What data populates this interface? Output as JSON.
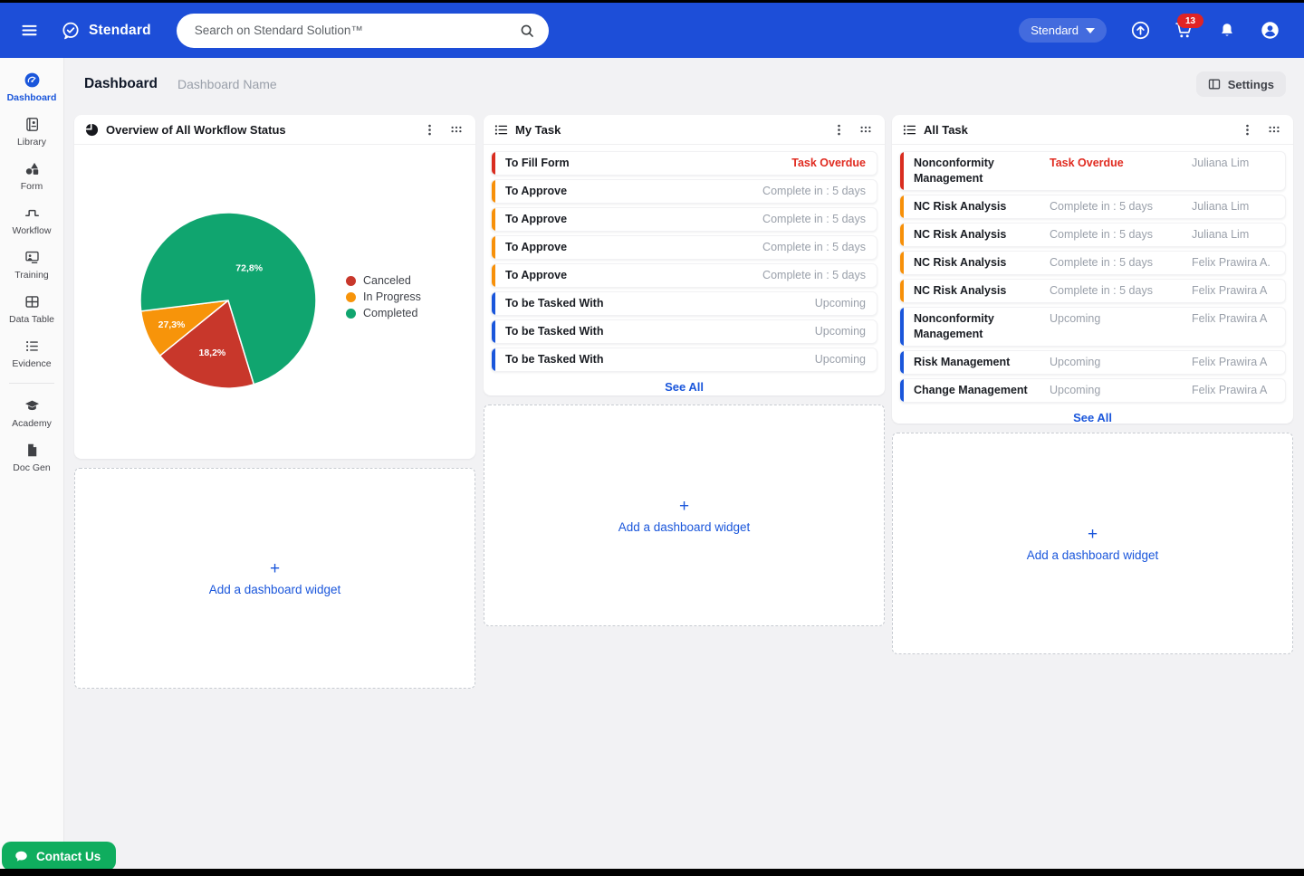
{
  "navbar": {
    "brand": "Stendard",
    "search_placeholder": "Search on Stendard Solution™",
    "org_selector": "Stendard",
    "cart_badge": "13"
  },
  "sidebar": {
    "sections": [
      {
        "items": [
          {
            "label": "Dashboard",
            "icon": "dashboard-icon",
            "active": true
          },
          {
            "label": "Library",
            "icon": "library-icon"
          },
          {
            "label": "Form",
            "icon": "form-icon"
          },
          {
            "label": "Workflow",
            "icon": "workflow-icon"
          },
          {
            "label": "Training",
            "icon": "training-icon"
          },
          {
            "label": "Data Table",
            "icon": "data-table-icon"
          },
          {
            "label": "Evidence",
            "icon": "evidence-icon"
          }
        ]
      },
      {
        "items": [
          {
            "label": "Academy",
            "icon": "academy-icon"
          },
          {
            "label": "Doc Gen",
            "icon": "doc-gen-icon"
          }
        ]
      }
    ]
  },
  "header": {
    "title": "Dashboard",
    "subtitle": "Dashboard Name",
    "settings_label": "Settings"
  },
  "widgets": {
    "workflow_status": {
      "title": "Overview of All Workflow Status",
      "chart_data": {
        "type": "pie",
        "title": "Overview of All Workflow Status",
        "legend_position": "right",
        "slices": [
          {
            "name": "Canceled",
            "color": "#C8372B",
            "pct_label": "18,2%",
            "value_pct": 18.2,
            "start_deg": 163,
            "sweep_deg": 68,
            "label_r": 0.62
          },
          {
            "name": "In Progress",
            "color": "#F7940A",
            "pct_label": "27,3%",
            "value_pct": 27.3,
            "start_deg": 231,
            "sweep_deg": 32,
            "label_r": 0.7
          },
          {
            "name": "Completed",
            "color": "#10A56F",
            "pct_label": "72,8%",
            "value_pct": 72.8,
            "start_deg": 263,
            "sweep_deg": 260,
            "label_r": 0.44
          }
        ]
      }
    },
    "my_task": {
      "title": "My Task",
      "see_all": "See All",
      "rows": [
        {
          "title": "To Fill Form",
          "status": "Task Overdue",
          "status_type": "overdue"
        },
        {
          "title": "To Approve",
          "status": "Complete in : 5 days",
          "status_type": "due"
        },
        {
          "title": "To Approve",
          "status": "Complete in : 5 days",
          "status_type": "due"
        },
        {
          "title": "To Approve",
          "status": "Complete in : 5 days",
          "status_type": "due"
        },
        {
          "title": "To Approve",
          "status": "Complete in : 5 days",
          "status_type": "due"
        },
        {
          "title": "To be Tasked With",
          "status": "Upcoming",
          "status_type": "upcoming"
        },
        {
          "title": "To be Tasked With",
          "status": "Upcoming",
          "status_type": "upcoming"
        },
        {
          "title": "To be Tasked With",
          "status": "Upcoming",
          "status_type": "upcoming"
        }
      ]
    },
    "all_task": {
      "title": "All Task",
      "see_all": "See All",
      "rows": [
        {
          "title": "Nonconformity Management",
          "status": "Task Overdue",
          "assignee": "Juliana Lim",
          "status_type": "overdue"
        },
        {
          "title": "NC Risk Analysis",
          "status": "Complete in : 5 days",
          "assignee": "Juliana Lim",
          "status_type": "due"
        },
        {
          "title": "NC Risk Analysis",
          "status": "Complete in : 5 days",
          "assignee": "Juliana Lim",
          "status_type": "due"
        },
        {
          "title": "NC Risk Analysis",
          "status": "Complete in : 5 days",
          "assignee": "Felix Prawira A.",
          "status_type": "due"
        },
        {
          "title": "NC Risk Analysis",
          "status": "Complete in : 5 days",
          "assignee": "Felix Prawira A",
          "status_type": "due"
        },
        {
          "title": "Nonconformity Management",
          "status": "Upcoming",
          "assignee": "Felix Prawira A",
          "status_type": "upcoming"
        },
        {
          "title": "Risk Management",
          "status": "Upcoming",
          "assignee": "Felix Prawira A",
          "status_type": "upcoming"
        },
        {
          "title": "Change Management",
          "status": "Upcoming",
          "assignee": "Felix Prawira A",
          "status_type": "upcoming"
        }
      ]
    },
    "add_widget": {
      "plus": "+",
      "label": "Add a dashboard widget"
    }
  },
  "contact_us": {
    "label": "Contact Us"
  },
  "colors": {
    "primary_blue": "#1D4ED8",
    "link_blue": "#1A56DB",
    "overdue_red": "#E02B20",
    "bar_red": "#D92D20",
    "bar_orange": "#F79009",
    "bar_blue": "#1A56DB",
    "pie_green": "#10A56F",
    "pie_orange": "#F7940A",
    "pie_red": "#C8372B",
    "contact_green": "#0FAD5E",
    "badge_red": "#E02424"
  }
}
